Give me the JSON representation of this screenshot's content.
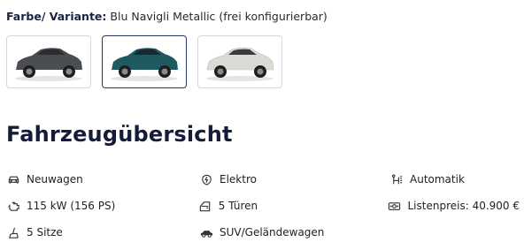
{
  "variant": {
    "label": "Farbe/ Variante:",
    "value": "Blu Navigli Metallic (frei konfigurierbar)"
  },
  "swatches": [
    {
      "name": "dark-grey",
      "body_color": "#4a4d52",
      "selected": false
    },
    {
      "name": "blu-navigli",
      "body_color": "#1f5a60",
      "selected": true
    },
    {
      "name": "white",
      "body_color": "#dcdad4",
      "selected": false
    }
  ],
  "overview": {
    "title": "Fahrzeugübersicht",
    "specs": [
      {
        "icon": "car-icon",
        "text": "Neuwagen"
      },
      {
        "icon": "electric-icon",
        "text": "Elektro"
      },
      {
        "icon": "gear-shift-icon",
        "text": "Automatik"
      },
      {
        "icon": "engine-icon",
        "text": "115 kW (156 PS)"
      },
      {
        "icon": "door-icon",
        "text": "5 Türen"
      },
      {
        "icon": "price-tag-icon",
        "text": "Listenpreis: 40.900 €"
      },
      {
        "icon": "seat-icon",
        "text": "5 Sitze"
      },
      {
        "icon": "suv-icon",
        "text": "SUV/Geländewagen"
      },
      {
        "icon": "",
        "text": ""
      }
    ]
  }
}
